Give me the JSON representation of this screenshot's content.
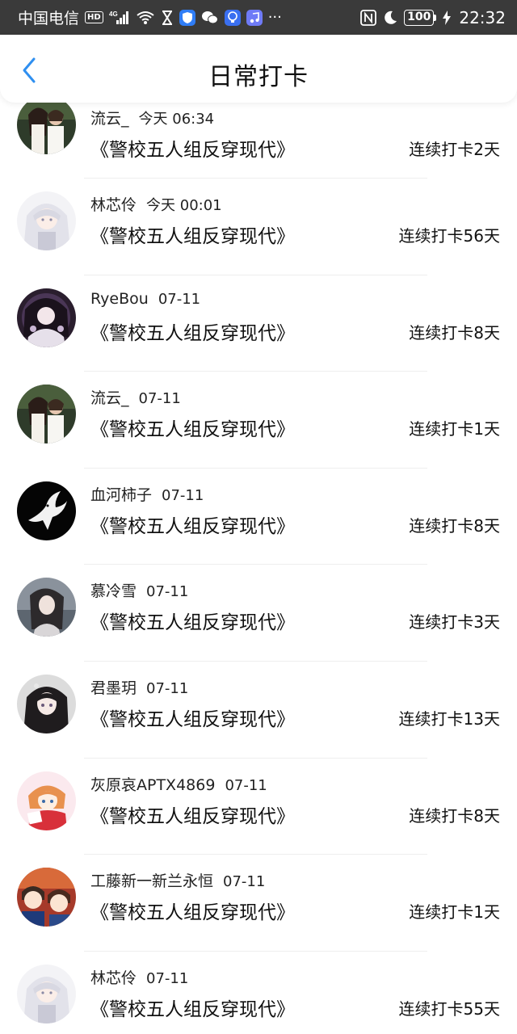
{
  "status_bar": {
    "carrier": "中国电信",
    "hd": "HD",
    "network": "4G",
    "battery": "100",
    "time": "22:32",
    "icons": [
      "signal-icon",
      "wifi-icon",
      "hourglass-icon",
      "shield-icon",
      "wechat-icon",
      "bulb-icon",
      "music-icon",
      "more-icon",
      "nfc-icon",
      "moon-icon",
      "charging-icon"
    ]
  },
  "header": {
    "title": "日常打卡",
    "back_icon": "chevron-left-icon",
    "accent_color": "#2f8ff0"
  },
  "entries": [
    {
      "user": "流云_",
      "time": "今天 06:34",
      "book": "《警校五人组反穿现代》",
      "streak": "连续打卡2天",
      "avatar_icon": "avatar-couple"
    },
    {
      "user": "林芯伶",
      "time": "今天 00:01",
      "book": "《警校五人组反穿现代》",
      "streak": "连续打卡56天",
      "avatar_icon": "avatar-white-hair-girl"
    },
    {
      "user": "RyeBou",
      "time": "07-11",
      "book": "《警校五人组反穿现代》",
      "streak": "连续打卡8天",
      "avatar_icon": "avatar-gothic-girl"
    },
    {
      "user": "流云_",
      "time": "07-11",
      "book": "《警校五人组反穿现代》",
      "streak": "连续打卡1天",
      "avatar_icon": "avatar-couple"
    },
    {
      "user": "血河柿子",
      "time": "07-11",
      "book": "《警校五人组反穿现代》",
      "streak": "连续打卡8天",
      "avatar_icon": "avatar-dove"
    },
    {
      "user": "慕冷雪",
      "time": "07-11",
      "book": "《警校五人组反穿现代》",
      "streak": "连续打卡3天",
      "avatar_icon": "avatar-dark-hair-girl"
    },
    {
      "user": "君墨玥",
      "time": "07-11",
      "book": "《警校五人组反穿现代》",
      "streak": "连续打卡13天",
      "avatar_icon": "avatar-black-hair-girl"
    },
    {
      "user": "灰原哀APTX4869",
      "time": "07-11",
      "book": "《警校五人组反穿现代》",
      "streak": "连续打卡8天",
      "avatar_icon": "avatar-orange-hair-girl"
    },
    {
      "user": "工藤新一新兰永恒",
      "time": "07-11",
      "book": "《警校五人组反穿现代》",
      "streak": "连续打卡1天",
      "avatar_icon": "avatar-anime-couple"
    },
    {
      "user": "林芯伶",
      "time": "07-11",
      "book": "《警校五人组反穿现代》",
      "streak": "连续打卡55天",
      "avatar_icon": "avatar-white-hair-girl"
    }
  ]
}
